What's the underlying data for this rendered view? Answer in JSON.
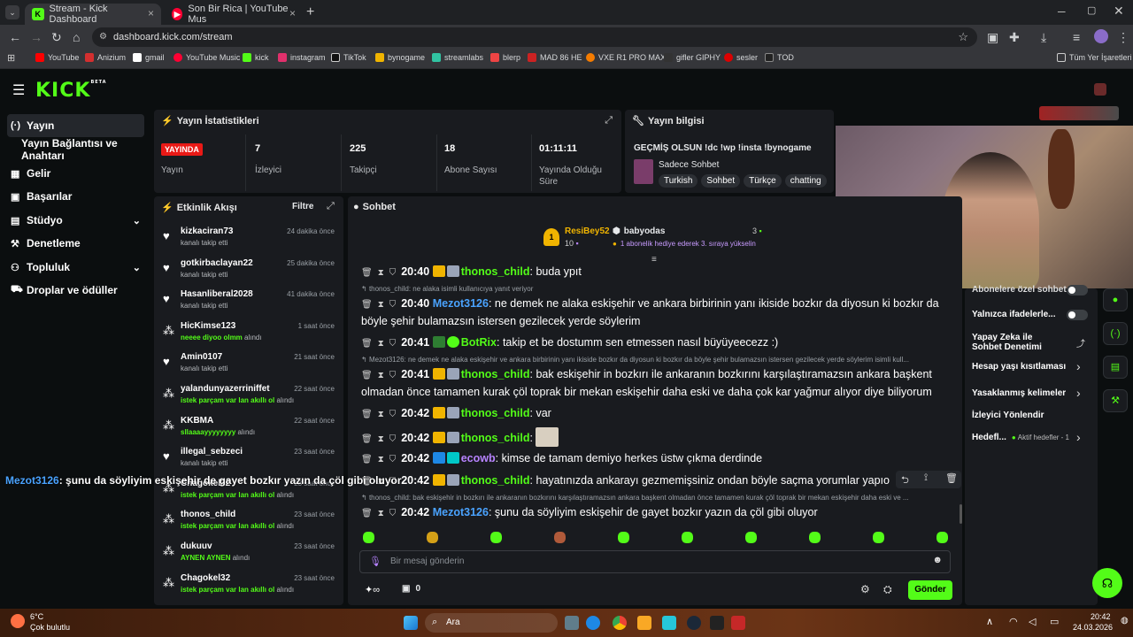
{
  "browser": {
    "tabs": [
      {
        "title": "Stream - Kick Dashboard"
      },
      {
        "title": "Son Bir Rica | YouTube Mus"
      }
    ],
    "url": "dashboard.kick.com/stream",
    "bookmarks": [
      "YouTube",
      "Anizium",
      "gmail",
      "YouTube Music",
      "kick",
      "instagram",
      "TikTok",
      "bynogame",
      "streamlabs",
      "blerp",
      "MAD 86 HE",
      "VXE R1 PRO MAX",
      "gifler GIPHY",
      "sesler",
      "TOD"
    ],
    "bookmarks_all": "Tüm Yer İşaretleri"
  },
  "brand": {
    "logo": "KICK",
    "beta": "BETA",
    "color": "#53fc18"
  },
  "sidebar": {
    "items": [
      {
        "label": "Yayın",
        "icon": "broadcast-icon"
      },
      {
        "label": "Yayın Bağlantısı ve Anahtarı"
      },
      {
        "label": "Gelir",
        "icon": "revenue-icon"
      },
      {
        "label": "Başarılar",
        "icon": "achievement-icon"
      },
      {
        "label": "Stüdyo",
        "icon": "studio-icon"
      },
      {
        "label": "Denetleme",
        "icon": "moderation-icon"
      },
      {
        "label": "Topluluk",
        "icon": "community-icon"
      },
      {
        "label": "Droplar ve ödüller",
        "icon": "drops-icon"
      }
    ]
  },
  "stats": {
    "title": "Yayın İstatistikleri",
    "live_badge": "YAYINDA",
    "status_label": "Yayın",
    "viewers": "7",
    "viewers_label": "İzleyici",
    "followers": "225",
    "followers_label": "Takipçi",
    "subs": "18",
    "subs_label": "Abone Sayısı",
    "duration": "01:11:11",
    "duration_label": "Yayında Olduğu Süre"
  },
  "stream_info": {
    "title": "Yayın bilgisi",
    "stream_title": "GEÇMİŞ OLSUN !dc !wp !insta !bynogame",
    "category": "Sadece Sohbet",
    "tags": [
      "Turkish",
      "Sohbet",
      "Türkçe",
      "chatting"
    ]
  },
  "activity": {
    "title": "Etkinlik Akışı",
    "filter": "Filtre",
    "items": [
      {
        "name": "kizkaciran73",
        "time": "24 dakika önce",
        "sub": "kanalı takip etti",
        "type": "follow"
      },
      {
        "name": "gotkirbaclayan22",
        "time": "25 dakika önce",
        "sub": "kanalı takip etti",
        "type": "follow"
      },
      {
        "name": "Hasanliberal2028",
        "time": "41 dakika önce",
        "sub": "kanalı takip etti",
        "type": "follow"
      },
      {
        "name": "HicKimse123",
        "time": "1 saat önce",
        "reward": "neeee diyoo olmm",
        "suffix": "alındı",
        "type": "reward"
      },
      {
        "name": "Amin0107",
        "time": "21 saat önce",
        "sub": "kanalı takip etti",
        "type": "follow"
      },
      {
        "name": "yalandunyazerriniffet",
        "time": "22 saat önce",
        "reward": "istek parçam var lan akıllı ol",
        "suffix": "alındı",
        "type": "reward"
      },
      {
        "name": "KKBMA",
        "time": "22 saat önce",
        "reward": "sllaaaayyyyyyyy",
        "suffix": "alındı",
        "type": "reward"
      },
      {
        "name": "illegal_sebzeci",
        "time": "23 saat önce",
        "sub": "kanalı takip etti",
        "type": "follow"
      },
      {
        "name": "Chagokel32",
        "time": "23 saat önce",
        "reward": "istek parçam var lan akıllı ol",
        "suffix": "alındı",
        "type": "reward"
      },
      {
        "name": "thonos_child",
        "time": "23 saat önce",
        "reward": "istek parçam var lan akıllı ol",
        "suffix": "alındı",
        "type": "reward"
      },
      {
        "name": "dukuuv",
        "time": "23 saat önce",
        "reward": "AYNEN AYNEN",
        "suffix": "alındı",
        "type": "reward"
      },
      {
        "name": "Chagokel32",
        "time": "23 saat önce",
        "reward": "istek parçam var lan akıllı ol",
        "suffix": "alındı",
        "type": "reward"
      }
    ]
  },
  "chat": {
    "title": "Sohbet",
    "top_gifter": {
      "name": "ResiBey52",
      "count": "10",
      "rank": "1"
    },
    "gift_user": {
      "name": "babyodas",
      "count": "3",
      "note": "1 abonelik hediye ederek 3. sıraya yükselin"
    },
    "messages": [
      {
        "time": "20:40",
        "user": "thonos_child",
        "color": "green",
        "text": "buda ypıt"
      },
      {
        "reply": "thonos_child: ne alaka isimli kullanıcıya yanıt veriyor"
      },
      {
        "time": "20:40",
        "user": "Mezot3126",
        "color": "blue",
        "text": "ne demek ne alaka eskişehir ve ankara birbirinin yanı ikiside bozkır da diyosun ki bozkır da böyle şehir bulamazsın istersen gezilecek yerde söylerim"
      },
      {
        "time": "20:41",
        "user": "BotRix",
        "color": "green",
        "text": "takip et be dostumm sen etmessen nasıl büyüyeecezz :)"
      },
      {
        "reply": "Mezot3126: ne demek ne alaka eskişehir ve ankara birbirinin yanı ikiside bozkır da diyosun ki bozkır da böyle şehir bulamazsın istersen gezilecek yerde söylerim isimli kull..."
      },
      {
        "time": "20:41",
        "user": "thonos_child",
        "color": "green",
        "text": "bak eskişehir in bozkırı ile ankaranın bozkırını karşılaştıramazsın ankara başkent olmadan önce tamamen kurak çöl toprak bir mekan eskişehir daha eski ve daha çok kar yağmur alıyor diye biliyorum"
      },
      {
        "time": "20:42",
        "user": "thonos_child",
        "color": "green",
        "text": "var"
      },
      {
        "time": "20:42",
        "user": "thonos_child",
        "color": "green",
        "text": ""
      },
      {
        "time": "20:42",
        "user": "ecowb",
        "color": "purple",
        "text": "kimse de tamam demiyo herkes üstw çıkma derdinde"
      },
      {
        "time": "20:42",
        "user": "thonos_child",
        "color": "green",
        "text": "hayatınızda ankarayı gezmemişsiniz ondan böyle saçma yorumlar yapıo"
      },
      {
        "reply": "thonos_child: bak eskişehir in bozkırı ile ankaranın bozkırını karşılaştıramazsın ankara başkent olmadan önce tamamen kurak çöl toprak bir mekan eskişehir daha eski ve ..."
      },
      {
        "time": "20:42",
        "user": "Mezot3126",
        "color": "blue",
        "text": "şunu da söyliyim eskişehir de gayet bozkır yazın da çöl gibi oluyor"
      }
    ],
    "overlay": {
      "user": "Mezot3126",
      "text": "şunu da söyliyim eskişehir de gayet bozkır yazın da çöl gibi oluyor"
    },
    "input_placeholder": "Bir mesaj gönderin",
    "points": "0",
    "send": "Gönder"
  },
  "mod_settings": [
    {
      "label": "Abonelere özel sohbet",
      "toggle": true
    },
    {
      "label": "Yalnızca ifadelerle...",
      "toggle": true
    },
    {
      "label": "Yapay Zeka ile Sohbet Denetimi"
    },
    {
      "label": "Hesap yaşı kısıtlaması"
    },
    {
      "label": "Yasaklanmış kelimeler"
    },
    {
      "label": "İzleyici Yönlendir"
    },
    {
      "label": "Hedefl...",
      "extra": "Aktif hedefler - 1"
    }
  ],
  "taskbar": {
    "weather_temp": "6°C",
    "weather_desc": "Çok bulutlu",
    "search": "Ara",
    "clock": "20:42",
    "date": "24.03.2026"
  }
}
